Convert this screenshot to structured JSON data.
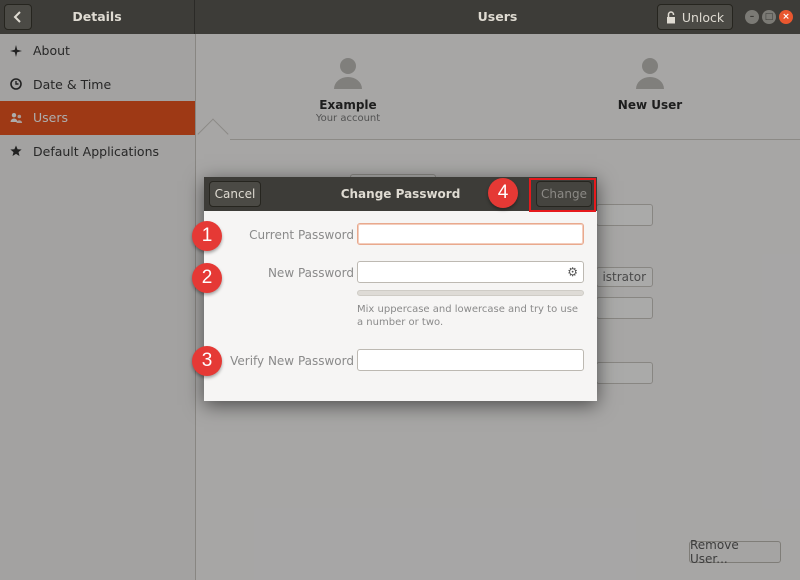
{
  "header": {
    "left_title": "Details",
    "title": "Users",
    "unlock_label": "Unlock",
    "window_controls": [
      "–",
      "□",
      "×"
    ]
  },
  "sidebar": {
    "items": [
      {
        "label": "About",
        "icon": "star-sparkle-icon",
        "active": false
      },
      {
        "label": "Date & Time",
        "icon": "clock-icon",
        "active": false
      },
      {
        "label": "Users",
        "icon": "users-icon",
        "active": true
      },
      {
        "label": "Default Applications",
        "icon": "star-icon",
        "active": false
      }
    ]
  },
  "users": [
    {
      "name": "Example",
      "subtitle": "Your account"
    },
    {
      "name": "New User",
      "subtitle": ""
    }
  ],
  "background": {
    "account_type_label": "istrator",
    "remove_user_label": "Remove User..."
  },
  "dialog": {
    "title": "Change Password",
    "cancel_label": "Cancel",
    "change_label": "Change",
    "current_password_label": "Current Password",
    "current_password_value": "",
    "new_password_label": "New Password",
    "new_password_value": "",
    "verify_password_label": "Verify New Password",
    "verify_password_value": "",
    "hint": "Mix uppercase and lowercase and try to use a number or two.",
    "strength": 0
  },
  "callouts": [
    "1",
    "2",
    "3",
    "4"
  ],
  "colors": {
    "accent": "#e95420",
    "header": "#3d3c38",
    "callout": "#e53935"
  }
}
